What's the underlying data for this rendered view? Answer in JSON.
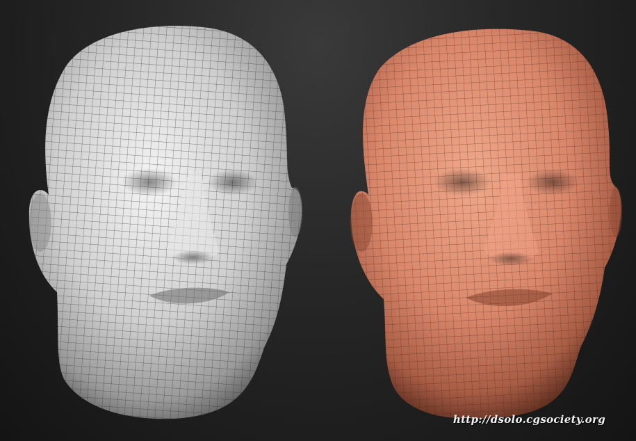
{
  "scene": {
    "left_head": {
      "label": "grey-wireframe-head",
      "color": "#d9d9d9",
      "wire": "#2a2a2a"
    },
    "right_head": {
      "label": "skin-wireframe-head",
      "color": "#d9876b",
      "wire": "#4a2418"
    },
    "background": "#262626"
  },
  "credit": {
    "text": "http://dsolo.cgsociety.org"
  }
}
